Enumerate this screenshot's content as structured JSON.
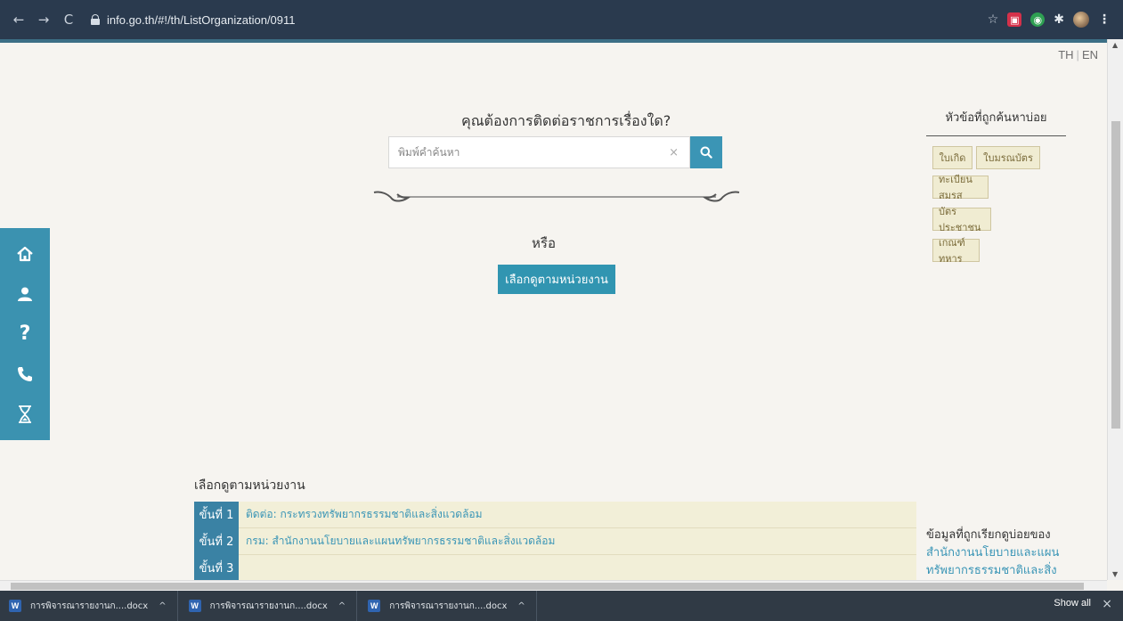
{
  "browser": {
    "url": "info.go.th/#!/th/ListOrganization/0911",
    "back_icon": "←",
    "forward_icon": "→",
    "reload_icon": "C"
  },
  "lang": {
    "th": "TH",
    "sep": "|",
    "en": "EN"
  },
  "search": {
    "question": "คุณต้องการติดต่อราชการเรื่องใด?",
    "placeholder": "พิมพ์คำค้นหา",
    "clear": "×"
  },
  "or_text": "หรือ",
  "pick_button": "เลือกดูตามหน่วยงาน",
  "popular": {
    "title": "หัวข้อที่ถูกค้นหาบ่อย",
    "tags": [
      "ใบเกิด",
      "ใบมรณบัตร",
      "ทะเบียนสมรส",
      "บัตรประชาชน",
      "เกณฑ์ทหาร"
    ]
  },
  "sidebar": [
    "home-icon",
    "user-icon",
    "help-icon",
    "phone-icon",
    "hourglass-icon"
  ],
  "section": {
    "title": "เลือกดูตามหน่วยงาน",
    "steps": [
      {
        "num": "ขั้นที่ 1",
        "text": "ติดต่อ: กระทรวงทรัพยากรธรรมชาติและสิ่งแวดล้อม"
      },
      {
        "num": "ขั้นที่ 2",
        "text": "กรม: สำนักงานนโยบายและแผนทรัพยากรธรรมชาติและสิ่งแวดล้อม"
      },
      {
        "num": "ขั้นที่ 3",
        "text": ""
      }
    ]
  },
  "info_right": {
    "title": "ข้อมูลที่ถูกเรียกดูบ่อยของ",
    "link_1": "สำนักงานนโยบายและแผน",
    "link_2": "ทรัพยากรธรรมชาติและสิ่ง"
  },
  "downloads": {
    "items": [
      "การพิจารณารายงานก....docx",
      "การพิจารณารายงานก....docx",
      "การพิจารณารายงานก....docx"
    ],
    "show_all": "Show all",
    "close": "×"
  }
}
